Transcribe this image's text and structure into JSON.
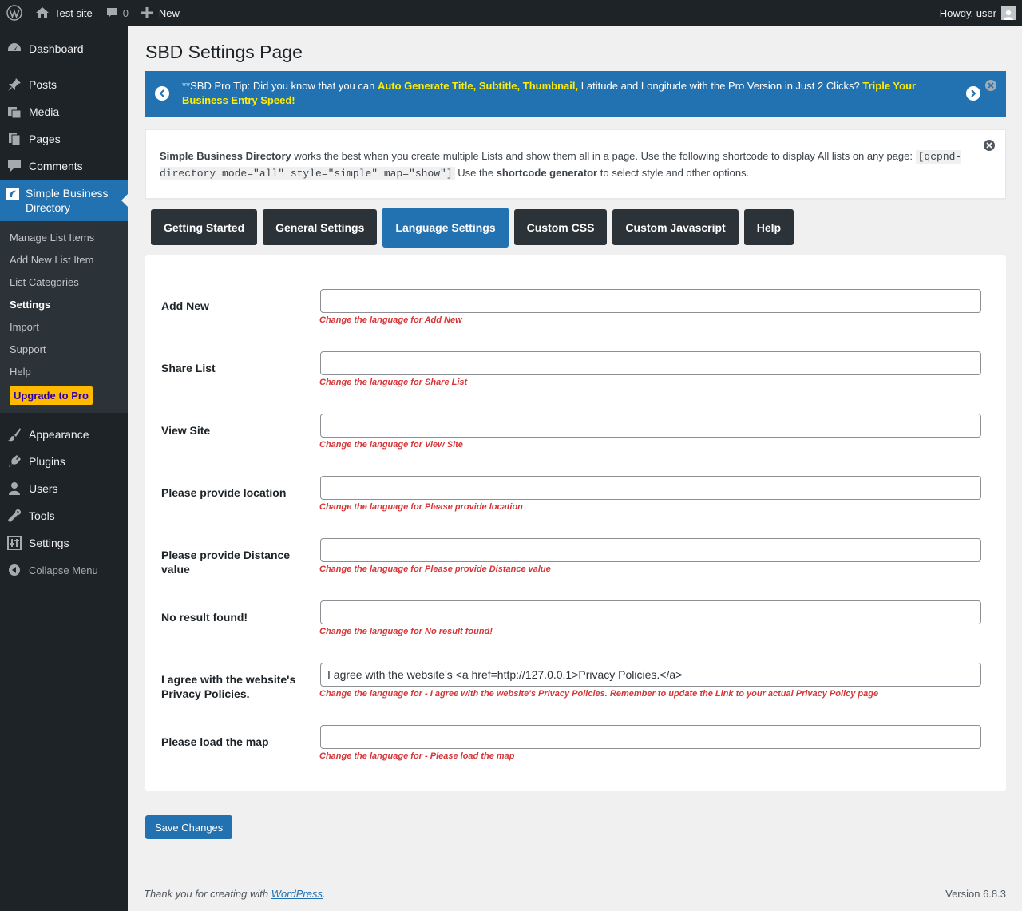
{
  "adminbar": {
    "site_name": "Test site",
    "comment_count": "0",
    "new_label": "New",
    "greeting": "Howdy, user"
  },
  "sidebar": {
    "items_top": [
      {
        "label": "Dashboard",
        "icon": "dashboard-icon"
      },
      {
        "label": "Posts",
        "icon": "pin-icon"
      },
      {
        "label": "Media",
        "icon": "media-icon"
      },
      {
        "label": "Pages",
        "icon": "pages-icon"
      },
      {
        "label": "Comments",
        "icon": "comment-icon"
      }
    ],
    "current": {
      "label": "Simple Business Directory",
      "icon": "directory-icon"
    },
    "submenu": [
      {
        "label": "Manage List Items"
      },
      {
        "label": "Add New List Item"
      },
      {
        "label": "List Categories"
      },
      {
        "label": "Settings"
      },
      {
        "label": "Import"
      },
      {
        "label": "Support"
      },
      {
        "label": "Help"
      }
    ],
    "upgrade_label": "Upgrade to Pro",
    "items_bottom": [
      {
        "label": "Appearance",
        "icon": "brush-icon"
      },
      {
        "label": "Plugins",
        "icon": "plugin-icon"
      },
      {
        "label": "Users",
        "icon": "users-icon"
      },
      {
        "label": "Tools",
        "icon": "wrench-icon"
      },
      {
        "label": "Settings",
        "icon": "sliders-icon"
      }
    ],
    "collapse_label": "Collapse Menu"
  },
  "page": {
    "title": "SBD Settings Page",
    "protip": {
      "prefix": "**SBD Pro Tip: Did you know that you can ",
      "highlight1": "Auto Generate Title, Subtitle, Thumbnail,",
      "middle": " Latitude and Longitude with the Pro Version in Just 2 Clicks? ",
      "highlight2": "Triple Your Business Entry Speed!"
    },
    "notice": {
      "plugin_name": "Simple Business Directory",
      "text1": " works the best when you create multiple Lists and show them all in a page. Use the following shortcode to display All lists on any page: ",
      "shortcode": "[qcpnd-directory mode=\"all\" style=\"simple\" map=\"show\"]",
      "text2": " Use the ",
      "generator": "shortcode generator",
      "text3": " to select style and other options."
    },
    "tabs": [
      {
        "label": "Getting Started",
        "active": false
      },
      {
        "label": "General Settings",
        "active": false
      },
      {
        "label": "Language Settings",
        "active": true
      },
      {
        "label": "Custom CSS",
        "active": false
      },
      {
        "label": "Custom Javascript",
        "active": false
      },
      {
        "label": "Help",
        "active": false
      }
    ],
    "fields": [
      {
        "label": "Add New",
        "value": "",
        "hint": "Change the language for Add New"
      },
      {
        "label": "Share List",
        "value": "",
        "hint": "Change the language for Share List"
      },
      {
        "label": "View Site",
        "value": "",
        "hint": "Change the language for View Site"
      },
      {
        "label": "Please provide location",
        "value": "",
        "hint": "Change the language for Please provide location"
      },
      {
        "label": "Please provide Distance value",
        "value": "",
        "hint": "Change the language for Please provide Distance value"
      },
      {
        "label": "No result found!",
        "value": "",
        "hint": "Change the language for No result found!"
      },
      {
        "label": "I agree with the website's Privacy Policies.",
        "value": "I agree with the website's <a href=http://127.0.0.1>Privacy Policies.</a>",
        "hint": "Change the language for - I agree with the website's Privacy Policies. Remember to update the Link to your actual Privacy Policy page"
      },
      {
        "label": "Please load the map",
        "value": "",
        "hint": "Change the language for - Please load the map"
      }
    ],
    "save_label": "Save Changes"
  },
  "footer": {
    "thanks_prefix": "Thank you for creating with ",
    "thanks_link": "WordPress",
    "thanks_suffix": ".",
    "version": "Version 6.8.3"
  },
  "colors": {
    "accent": "#2271b1",
    "adminbar_bg": "#1d2327",
    "highlight": "#ffee00",
    "hint_red": "#d63638",
    "upgrade_bg": "#ffb900"
  }
}
